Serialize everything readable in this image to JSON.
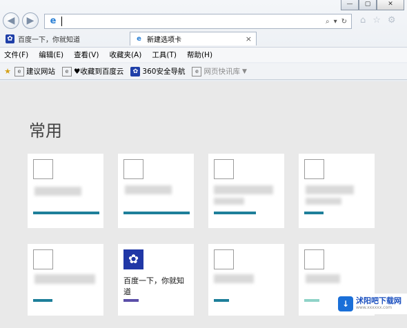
{
  "window": {
    "minimize": "—",
    "maximize": "▢",
    "close": "✕"
  },
  "nav": {
    "back": "◀",
    "forward": "▶"
  },
  "address": {
    "value": "",
    "ie_icon": "e",
    "search_glyph": "⌕",
    "dropdown_glyph": "▾",
    "refresh_glyph": "↻"
  },
  "right_icons": [
    "home-icon",
    "star-icon",
    "gear-icon"
  ],
  "tabs": [
    {
      "label": "百度一下，你就知道",
      "icon": "paw-icon"
    },
    {
      "label": "新建选项卡",
      "icon": "ie-icon",
      "close": "×"
    }
  ],
  "menu": [
    "文件(F)",
    "编辑(E)",
    "查看(V)",
    "收藏夹(A)",
    "工具(T)",
    "帮助(H)"
  ],
  "favorites": [
    {
      "label": "建议网站",
      "icon": "doc-icon"
    },
    {
      "label": "♥收藏到百度云",
      "icon": "doc-icon"
    },
    {
      "label": "360安全导航",
      "icon": "paw-icon"
    },
    {
      "label": "网页快讯库",
      "icon": "ie-icon",
      "has_dropdown": true
    }
  ],
  "section_title": "常用",
  "tiles": [
    {
      "label": "",
      "bar_color": "#1e7f9a",
      "bar_fraction": 0.87
    },
    {
      "label": "",
      "bar_color": "#1e7f9a",
      "bar_fraction": 0.87
    },
    {
      "label": "",
      "bar_color": "#1e7f9a",
      "bar_fraction": 0.55
    },
    {
      "label": "",
      "bar_color": "#1e7f9a",
      "bar_fraction": 0.25
    },
    {
      "label": "",
      "bar_color": "#1e7f9a",
      "bar_fraction": 0.25
    },
    {
      "label": "百度一下，你就知道",
      "bar_color": "#5b4fa8",
      "bar_fraction": 0.2
    },
    {
      "label": "",
      "bar_color": "#1e7f9a",
      "bar_fraction": 0.2
    },
    {
      "label": "",
      "bar_color": "#8fd3c8",
      "bar_fraction": 0.2
    }
  ],
  "watermark": {
    "main": "沭阳吧下载网",
    "sub": "www.xxxxxx.com"
  },
  "colors": {
    "accent": "#1e7f9a",
    "baidu": "#2037a6"
  }
}
